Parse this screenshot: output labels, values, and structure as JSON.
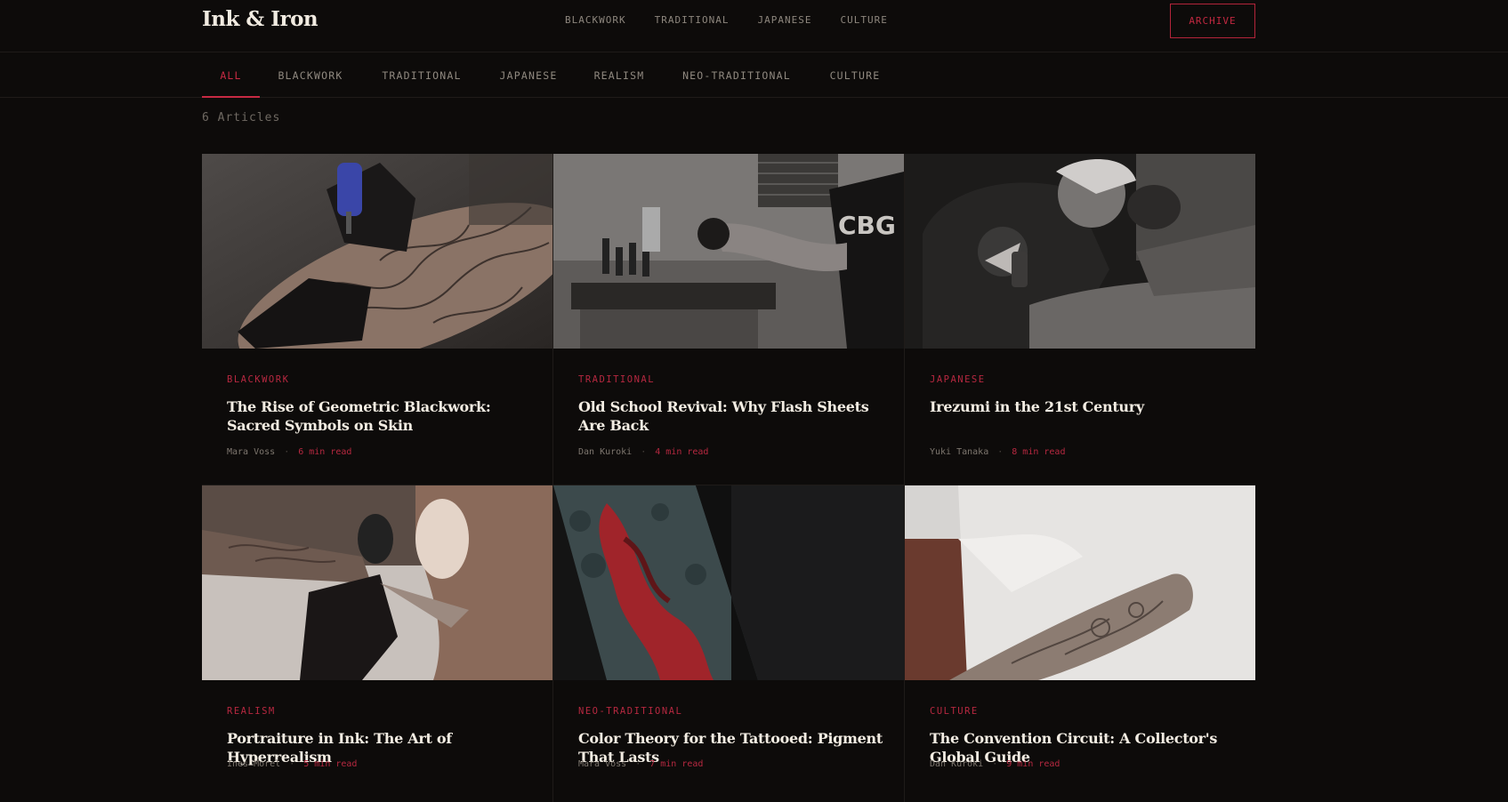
{
  "brand": {
    "logo": "Ink & Iron"
  },
  "topnav": [
    "BLACKWORK",
    "TRADITIONAL",
    "JAPANESE",
    "CULTURE"
  ],
  "archive_label": "ARCHIVE",
  "tabs": {
    "items": [
      "ALL",
      "BLACKWORK",
      "TRADITIONAL",
      "JAPANESE",
      "REALISM",
      "NEO-TRADITIONAL",
      "CULTURE"
    ],
    "active": "ALL"
  },
  "article_count": "6 Articles",
  "colors": {
    "accent": "#c72a43",
    "background": "#0d0b0a",
    "text": "#f2ece2",
    "muted": "#8d867d"
  },
  "articles": [
    {
      "tag": "BLACKWORK",
      "title": "The Rise of Geometric Blackwork: Sacred Symbols on Skin",
      "author": "Mara Voss",
      "read": "6 min read",
      "sep": "·",
      "image": "tattoo-machine-on-forearm-photo"
    },
    {
      "tag": "TRADITIONAL",
      "title": "Old School Revival: Why Flash Sheets Are Back",
      "author": "Dan Kuroki",
      "read": "4 min read",
      "sep": "·",
      "image": "studio-artist-at-workstation-photo"
    },
    {
      "tag": "JAPANESE",
      "title": "Irezumi in the 21st Century",
      "author": "Yuki Tanaka",
      "read": "8 min read",
      "sep": "·",
      "image": "artist-tattooing-client-photo"
    },
    {
      "tag": "REALISM",
      "title": "Portraiture in Ink: The Art of Hyperrealism",
      "author": "Ines Morel",
      "read": "5 min read",
      "sep": "·",
      "image": "gloved-hands-tattooing-photo"
    },
    {
      "tag": "NEO-TRADITIONAL",
      "title": "Color Theory for the Tattooed: Pigment That Lasts",
      "author": "Mara Voss",
      "read": "7 min read",
      "sep": "·",
      "image": "colored-sleeve-tattoo-photo"
    },
    {
      "tag": "CULTURE",
      "title": "The Convention Circuit: A Collector's Global Guide",
      "author": "Dan Kuroki",
      "read": "9 min read",
      "sep": "·",
      "image": "forearm-sleeve-white-shirt-photo"
    }
  ]
}
